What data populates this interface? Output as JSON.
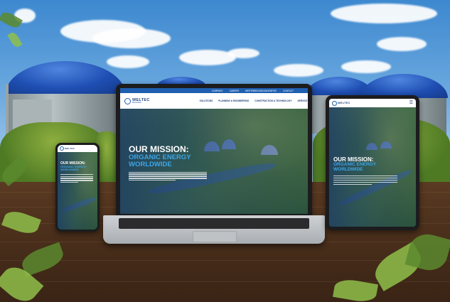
{
  "brand": {
    "logo_text": "WELTEC",
    "logo_sub": "BIOPOWER",
    "accent": "#1f5fb0",
    "highlight": "#3ea6e6"
  },
  "website": {
    "top_links": [
      "COMPANY",
      "CAREER",
      "WEITERBEKUNDUNGENFOR",
      "CONTACT"
    ],
    "nav_items": [
      "SOLUTIONS",
      "PLANNING & ENGINEERING",
      "CONSTRUCTION & TECHNOLOGY",
      "SERVICE"
    ],
    "hero_line1": "OUR MISSION:",
    "hero_line2": "ORGANIC ENERGY",
    "hero_line3": "WORLDWIDE"
  },
  "scene": {
    "devices": [
      "laptop",
      "smartphone",
      "tablet"
    ],
    "background": "biogas-plant-domes",
    "surface": "wooden-table"
  }
}
